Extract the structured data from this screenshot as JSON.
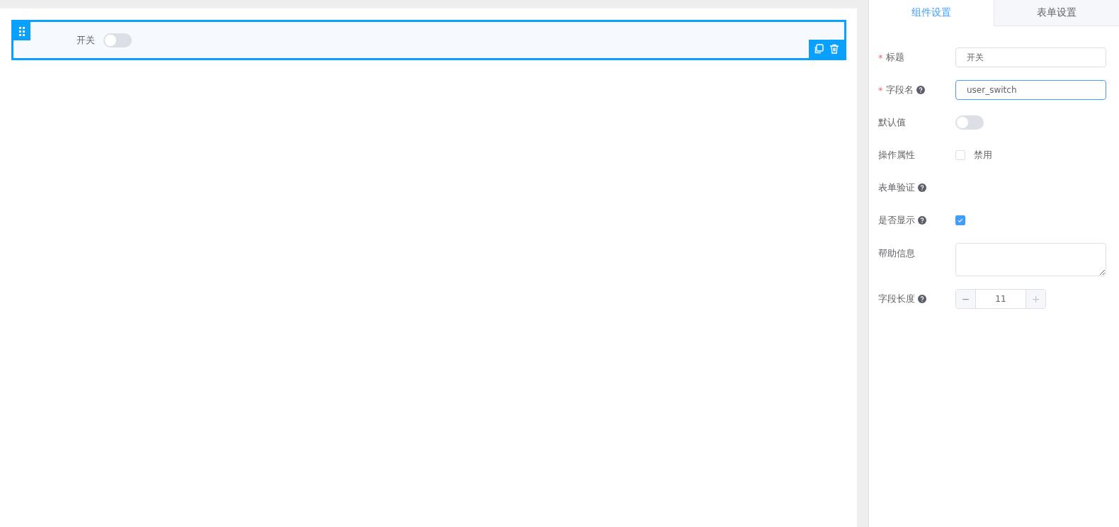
{
  "canvas": {
    "item": {
      "label": "开关",
      "on": false,
      "selected": true
    }
  },
  "tabs": [
    {
      "label": "组件设置",
      "selected": true
    },
    {
      "label": "表单设置",
      "selected": false
    }
  ],
  "fields": [
    {
      "kind": "text",
      "label": "标题",
      "required_mark": "*",
      "help": false,
      "value": "开关",
      "focused": false
    },
    {
      "kind": "text",
      "label": "字段名",
      "required_mark": "*",
      "help": true,
      "value": "user_switch",
      "focused": true
    },
    {
      "kind": "switch",
      "label": "默认值",
      "help": false,
      "on": false
    },
    {
      "kind": "checkbox",
      "label": "操作属性",
      "help": false,
      "checked": false,
      "option": "禁用"
    },
    {
      "kind": "none",
      "label": "表单验证",
      "help": true
    },
    {
      "kind": "checkbox",
      "label": "是否显示",
      "help": true,
      "checked": true
    },
    {
      "kind": "textarea",
      "label": "帮助信息",
      "help": false
    },
    {
      "kind": "number",
      "label": "字段长度",
      "help": true,
      "value": "11",
      "minus": "−",
      "plus": "+"
    }
  ]
}
